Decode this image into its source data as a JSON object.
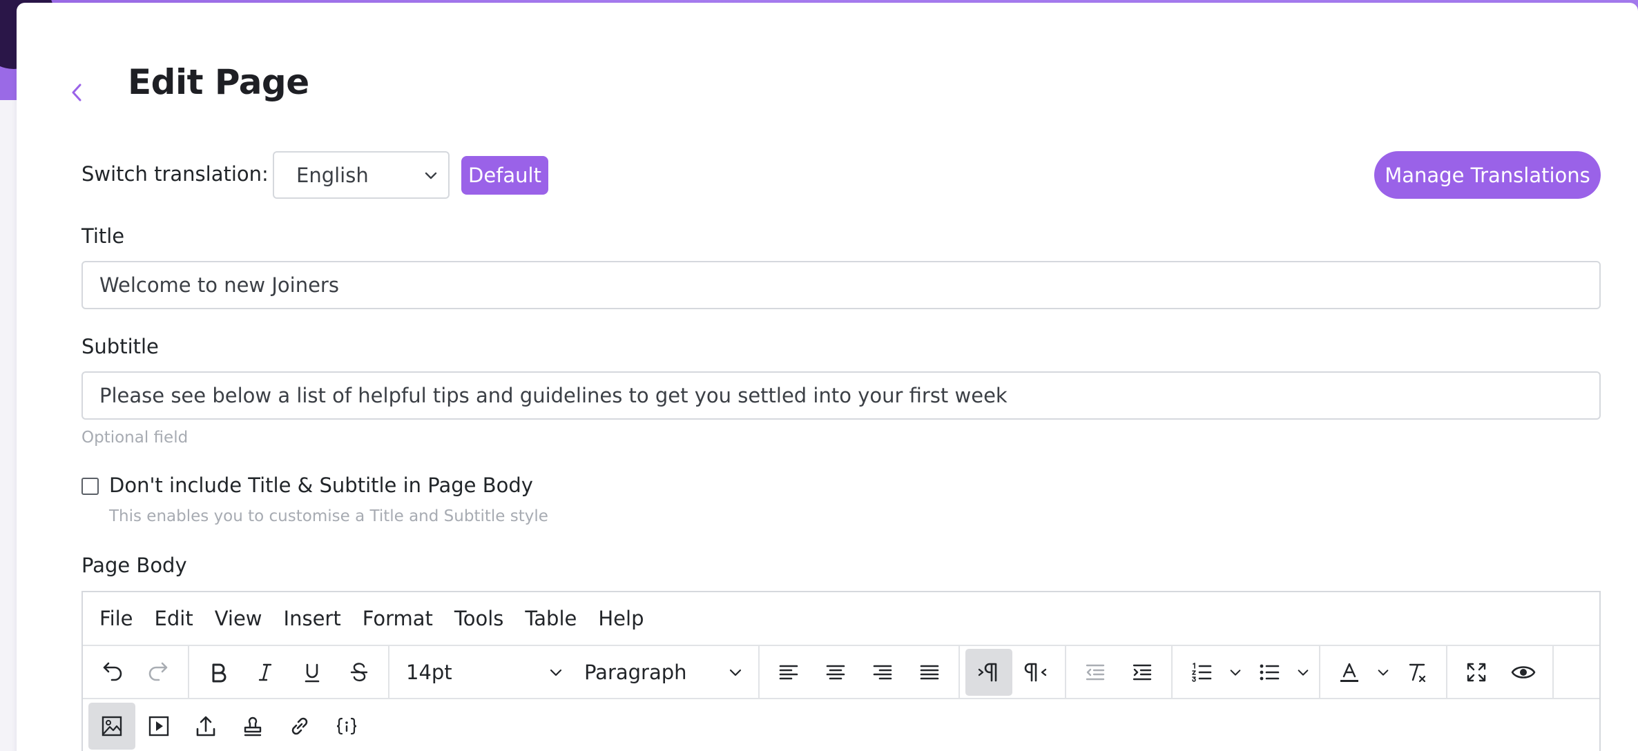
{
  "page": {
    "title": "Edit Page"
  },
  "translation": {
    "switch_label": "Switch translation:",
    "selected_language": "English",
    "default_badge": "Default",
    "manage_button": "Manage Translations"
  },
  "form": {
    "title_label": "Title",
    "title_value": "Welcome to new Joiners",
    "subtitle_label": "Subtitle",
    "subtitle_value": "Please see below a list of helpful tips and guidelines to get you settled into your first week",
    "subtitle_hint": "Optional field",
    "exclude_checkbox_label": "Don't include Title & Subtitle in Page Body",
    "exclude_checkbox_checked": false,
    "exclude_checkbox_hint": "This enables you to customise a Title and Subtitle style",
    "body_label": "Page Body"
  },
  "editor": {
    "menu": [
      "File",
      "Edit",
      "View",
      "Insert",
      "Format",
      "Tools",
      "Table",
      "Help"
    ],
    "font_size": "14pt",
    "block_format": "Paragraph"
  },
  "colors": {
    "accent": "#9a62e8",
    "hero": "#a77cf0"
  }
}
